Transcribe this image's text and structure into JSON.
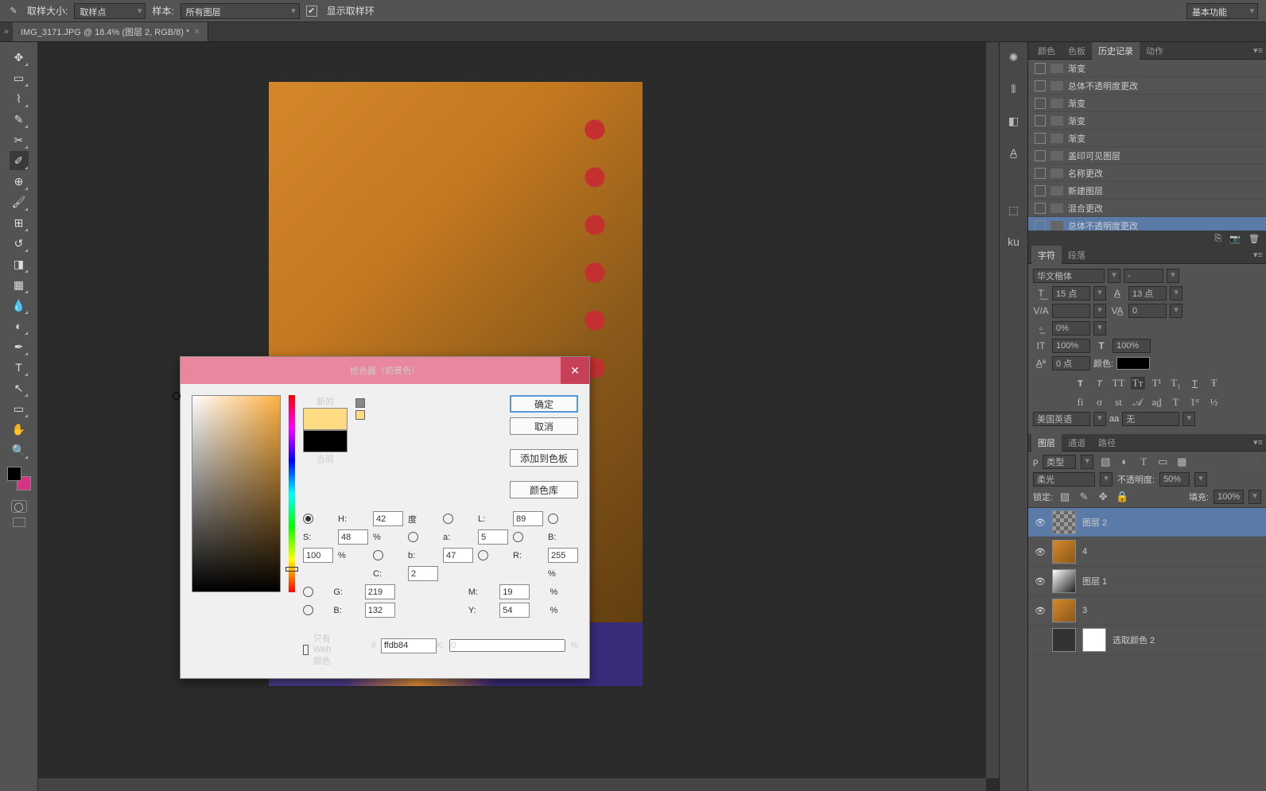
{
  "options_bar": {
    "sample_size_label": "取样大小:",
    "sample_size_value": "取样点",
    "sample_label": "样本:",
    "sample_value": "所有图层",
    "show_ring_label": "显示取样环"
  },
  "workspace": {
    "label": "基本功能"
  },
  "tab": {
    "title": "IMG_3171.JPG @ 18.4% (图层 2, RGB/8) *"
  },
  "picker": {
    "title": "拾色器（前景色）",
    "new_label": "新的",
    "current_label": "当前",
    "btn_ok": "确定",
    "btn_cancel": "取消",
    "btn_add": "添加到色板",
    "btn_lib": "颜色库",
    "H_label": "H:",
    "H": "42",
    "H_unit": "度",
    "S_label": "S:",
    "S": "48",
    "S_unit": "%",
    "Bv_label": "B:",
    "Bv": "100",
    "Bv_unit": "%",
    "R_label": "R:",
    "R": "255",
    "G_label": "G:",
    "G": "219",
    "B_label": "B:",
    "B": "132",
    "L_label": "L:",
    "L": "89",
    "a_label": "a:",
    "a": "5",
    "b_label": "b:",
    "b": "47",
    "C_label": "C:",
    "C": "2",
    "C_unit": "%",
    "M_label": "M:",
    "M": "19",
    "M_unit": "%",
    "Y_label": "Y:",
    "Y": "54",
    "Y_unit": "%",
    "K_label": "K:",
    "K": "0",
    "K_unit": "%",
    "web_only": "只有 Web 颜色",
    "hash": "#",
    "hex": "ffdb84",
    "new_color": "#ffdb84"
  },
  "panel_tabs": {
    "color": "颜色",
    "swatches": "色板",
    "history": "历史记录",
    "actions": "动作",
    "char": "字符",
    "para": "段落",
    "layers": "图层",
    "channels": "通道",
    "paths": "路径"
  },
  "history": {
    "items": [
      {
        "label": "渐变"
      },
      {
        "label": "总体不透明度更改"
      },
      {
        "label": "渐变"
      },
      {
        "label": "渐变"
      },
      {
        "label": "渐变"
      },
      {
        "label": "盖印可见图层"
      },
      {
        "label": "名称更改"
      },
      {
        "label": "新建图层"
      },
      {
        "label": "混合更改"
      },
      {
        "label": "总体不透明度更改"
      }
    ]
  },
  "character": {
    "font": "华文楷体",
    "style": "-",
    "size": "15 点",
    "leading": "13 点",
    "kerning": "",
    "tracking": "0",
    "height": "0%",
    "vscale": "100%",
    "hscale": "100%",
    "baseline": "0 点",
    "color_label": "颜色:",
    "lang": "美国英语",
    "aa": "无",
    "aa_prefix": "aa"
  },
  "layers_opts": {
    "type_prefix": "ρ",
    "type": "类型",
    "blend": "柔光",
    "opacity_label": "不透明度:",
    "opacity": "50%",
    "lock_label": "锁定:",
    "fill_label": "填充:",
    "fill": "100%"
  },
  "layers": {
    "items": [
      {
        "name": "图层 2"
      },
      {
        "name": "4"
      },
      {
        "name": "图层 1"
      },
      {
        "name": "3"
      },
      {
        "name": "选取颜色 2"
      }
    ]
  }
}
